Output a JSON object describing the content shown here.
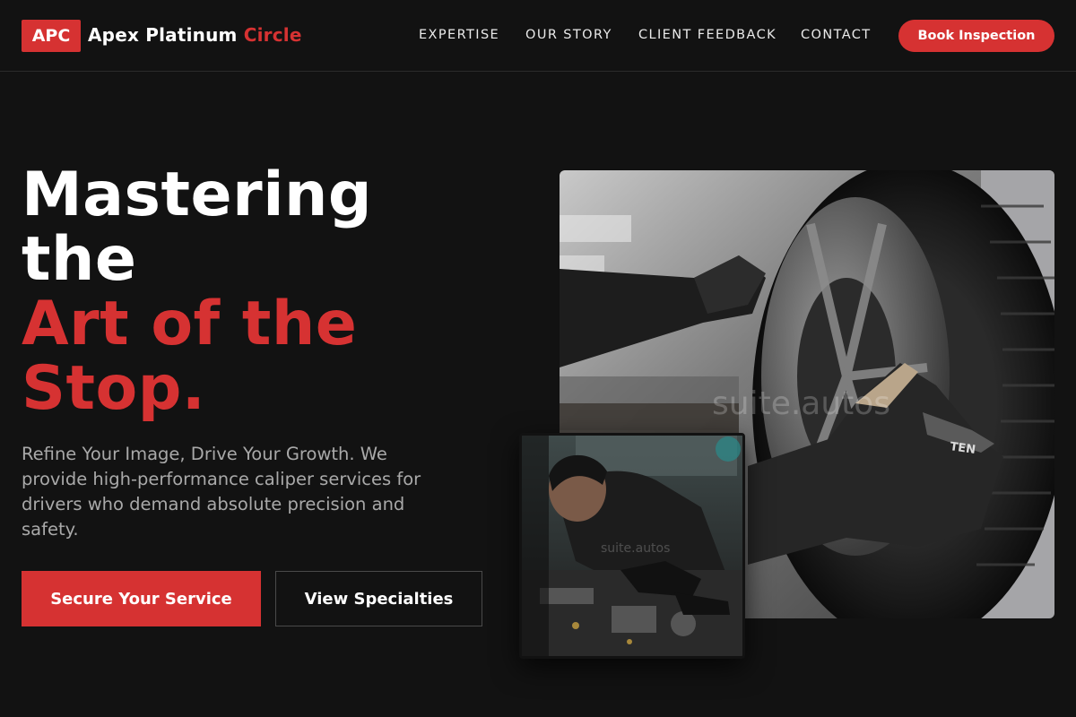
{
  "brand": {
    "badge": "APC",
    "name": "Apex Platinum",
    "name_accent": "Circle"
  },
  "nav": {
    "links": [
      "EXPERTISE",
      "OUR STORY",
      "CLIENT FEEDBACK",
      "CONTACT"
    ],
    "cta": "Book Inspection"
  },
  "hero": {
    "headline_lines": [
      "Mastering",
      "the",
      "Art of the",
      "Stop."
    ],
    "subtitle": "Refine Your Image, Drive Your Growth. We provide high-performance caliper services for drivers who demand absolute precision and safety.",
    "primary_cta": "Secure Your Service",
    "secondary_cta": "View Specialties"
  },
  "images": {
    "main_watermark": "suite.autos",
    "inset_watermark": "suite.autos"
  },
  "colors": {
    "accent": "#d63232",
    "background": "#121212",
    "muted_text": "#a9a9a9"
  }
}
